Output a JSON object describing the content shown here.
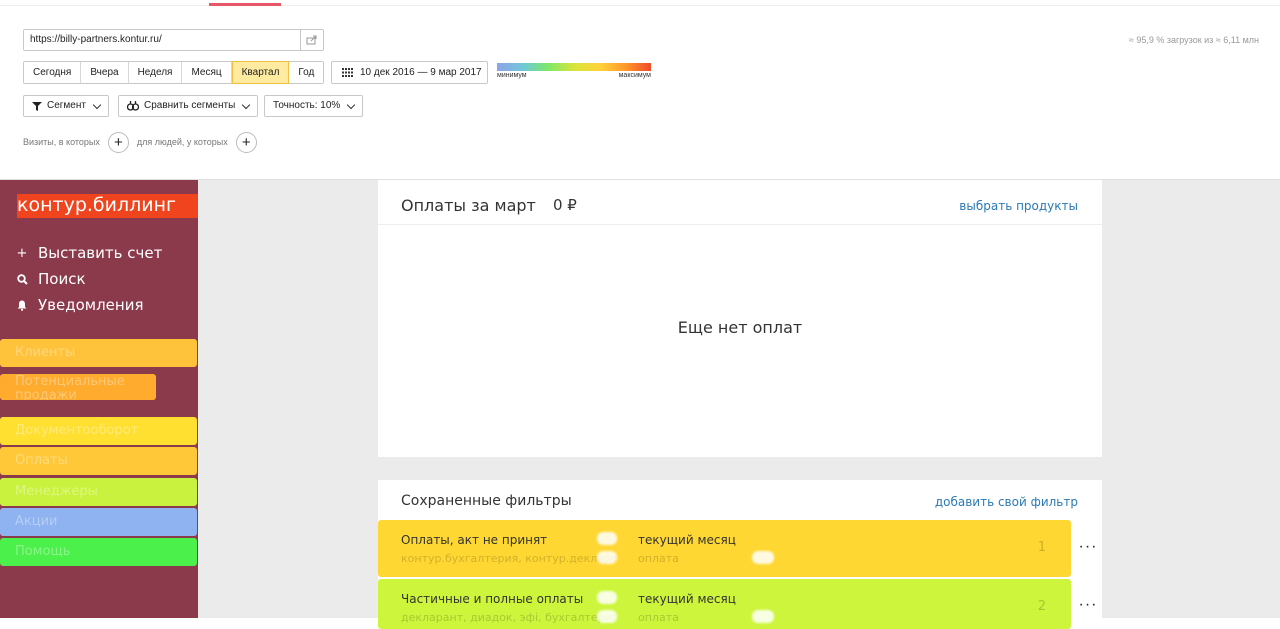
{
  "toolbar": {
    "url": "https://billy-partners.kontur.ru/",
    "load_info": "≈ 95,9 % загрузок из ≈ 6,11 млн",
    "periods": [
      "Сегодня",
      "Вчера",
      "Неделя",
      "Месяц",
      "Квартал",
      "Год"
    ],
    "active_period": "Квартал",
    "date_range": "10 дек 2016 — 9 мар 2017",
    "legend_min": "минимум",
    "legend_max": "максимум",
    "segment_label": "Сегмент",
    "compare_label": "Сравнить сегменты",
    "accuracy_label": "Точность: 10%",
    "visits_label": "Визиты, в которых",
    "people_label": "для людей, у которых"
  },
  "sidebar": {
    "logo": "контур.биллинг",
    "actions": [
      {
        "icon": "plus-icon",
        "label": "Выставить счет"
      },
      {
        "icon": "search-icon",
        "label": "Поиск"
      },
      {
        "icon": "bell-icon",
        "label": "Уведомления"
      }
    ],
    "items": [
      {
        "label": "Клиенты",
        "color": "#ffc23a"
      },
      {
        "label": "Потенциальные продажи",
        "color": "#ffab2e"
      },
      {
        "label": "Документооборот",
        "color": "#ffdf30"
      },
      {
        "label": "Оплаты",
        "color": "#ffc838"
      },
      {
        "label": "Менеджеры",
        "color": "#c9f23e"
      },
      {
        "label": "Акции",
        "color": "#8fb3f0"
      },
      {
        "label": "Помощь",
        "color": "#4cf04a"
      }
    ]
  },
  "payments_card": {
    "title": "Оплаты за март",
    "amount": "0 ₽",
    "link": "выбрать продукты",
    "empty_text": "Еще нет оплат"
  },
  "filters_card": {
    "title": "Сохраненные фильтры",
    "link": "добавить свой фильтр",
    "items": [
      {
        "name": "Оплаты, акт не принят",
        "sub": "контур.бухгалтерия, контур.декларант",
        "period": "текущий месяц",
        "type": "оплата",
        "count": "1",
        "color": "#ffd732"
      },
      {
        "name": "Частичные и полные оплаты",
        "sub": "декларант, диадок, эфі, бухгалтерия",
        "period": "текущий месяц",
        "type": "оплата",
        "count": "2",
        "color": "#cdf53c"
      }
    ]
  }
}
